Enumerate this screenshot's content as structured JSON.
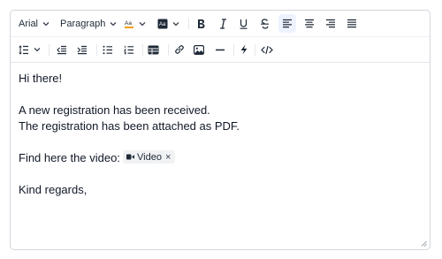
{
  "toolbar": {
    "font_family": "Arial",
    "block_format": "Paragraph",
    "font_size_icon": "Aa",
    "bg_color_icon": "Aa"
  },
  "content": {
    "line1": "Hi there!",
    "line2": "A new registration has been received.",
    "line3": "The registration has been attached as PDF.",
    "line4": "Find here the video:",
    "chip_label": "Video",
    "chip_close": "×",
    "line5": "Kind regards,"
  },
  "colors": {
    "border": "#d1d5db",
    "active_bg": "#eef2ff",
    "chip_bg": "#f1f2f4",
    "text": "#111827"
  }
}
